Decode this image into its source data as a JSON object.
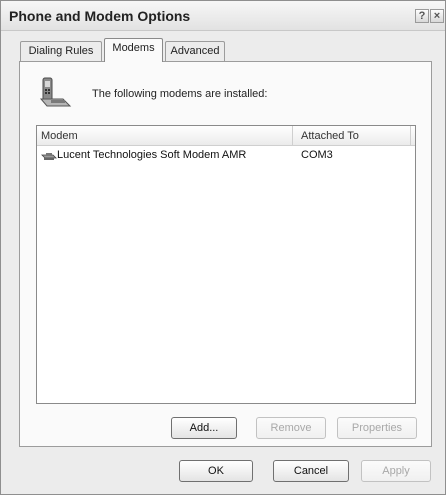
{
  "window": {
    "title": "Phone and Modem Options",
    "help_glyph": "?",
    "close_glyph": "×"
  },
  "tabs": [
    {
      "label": "Dialing Rules",
      "selected": false
    },
    {
      "label": "Modems",
      "selected": true
    },
    {
      "label": "Advanced",
      "selected": false
    }
  ],
  "modems_tab": {
    "description": "The following modems are  installed:",
    "icon": "phone-modem-icon",
    "list": {
      "columns": [
        "Modem",
        "Attached To"
      ],
      "rows": [
        {
          "icon": "modem-icon",
          "modem": "Lucent Technologies Soft Modem AMR",
          "attached_to": "COM3"
        }
      ]
    },
    "buttons": {
      "add": "Add...",
      "remove": "Remove",
      "properties": "Properties"
    }
  },
  "footer": {
    "ok": "OK",
    "cancel": "Cancel",
    "apply": "Apply"
  }
}
